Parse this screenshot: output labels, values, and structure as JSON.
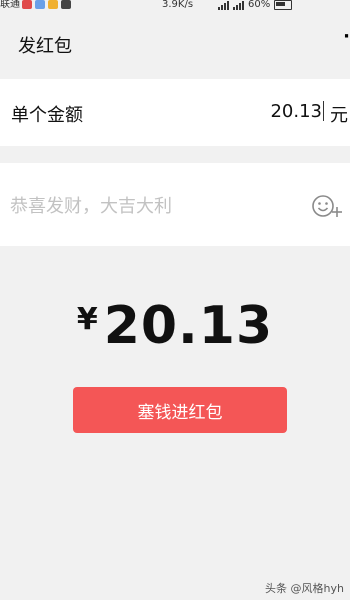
{
  "status_bar": {
    "carrier": "联通",
    "net_speed": "3.9K/s",
    "battery": "60%"
  },
  "header": {
    "title": "发红包",
    "more_label": "·"
  },
  "amount_row": {
    "label": "单个金额",
    "value": "20.13",
    "unit": "元"
  },
  "greeting": {
    "placeholder": "恭喜发财，大吉大利",
    "emoji_icon": "emoji-add-icon"
  },
  "display": {
    "currency": "¥",
    "amount": "20.13"
  },
  "send_button": {
    "label": "塞钱进红包",
    "color": "#f45656"
  },
  "watermark": "头条 @风格hyh"
}
